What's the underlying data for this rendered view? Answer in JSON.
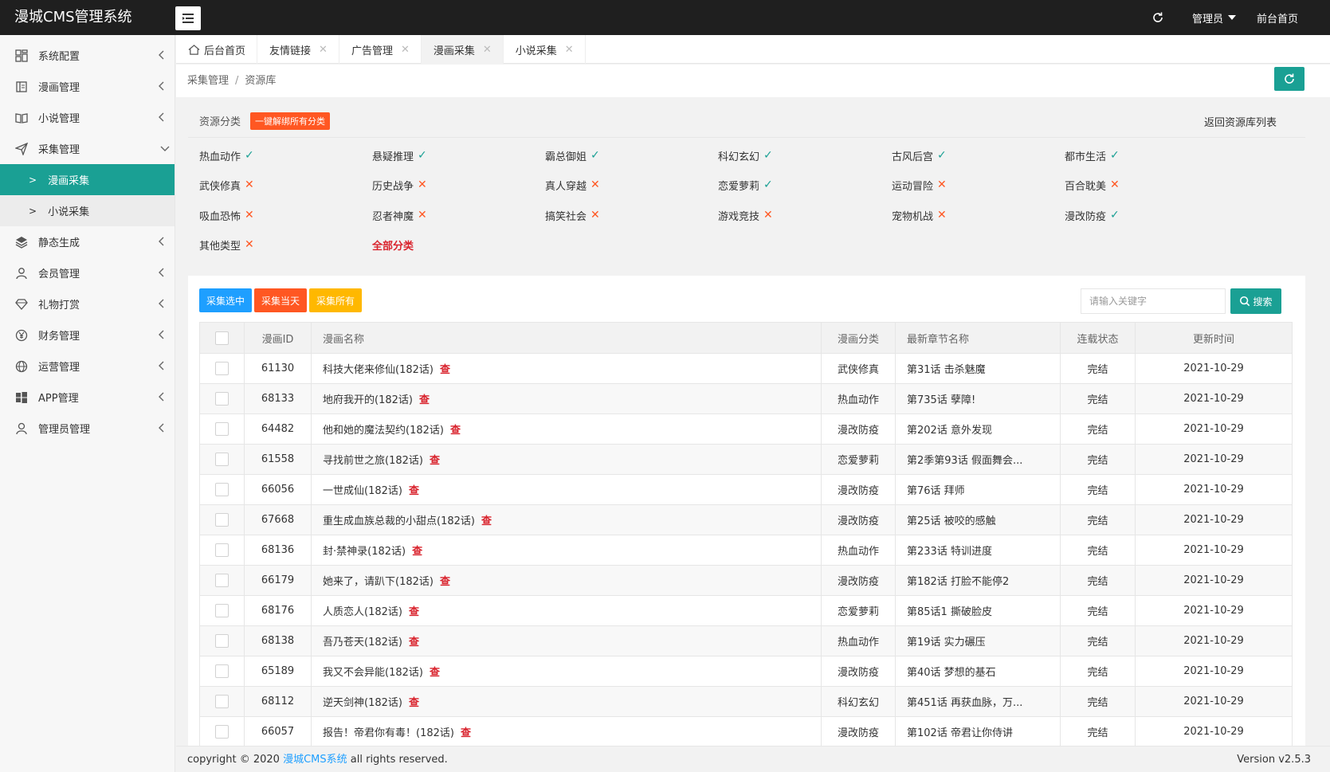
{
  "header": {
    "brand": "漫城CMS管理系统",
    "admin_label": "管理员",
    "front_label": "前台首页"
  },
  "sidebar": {
    "items": [
      {
        "label": "系统配置",
        "icon": "dashboard-icon"
      },
      {
        "label": "漫画管理",
        "icon": "book-icon"
      },
      {
        "label": "小说管理",
        "icon": "open-book-icon"
      },
      {
        "label": "采集管理",
        "icon": "paper-plane-icon",
        "expanded": true
      },
      {
        "label": "静态生成",
        "icon": "layers-icon"
      },
      {
        "label": "会员管理",
        "icon": "users-icon"
      },
      {
        "label": "礼物打赏",
        "icon": "diamond-icon"
      },
      {
        "label": "财务管理",
        "icon": "yen-icon"
      },
      {
        "label": "运营管理",
        "icon": "globe-icon"
      },
      {
        "label": "APP管理",
        "icon": "windows-icon"
      },
      {
        "label": "管理员管理",
        "icon": "user-icon"
      }
    ],
    "sub_items": [
      {
        "label": "漫画采集",
        "active": true
      },
      {
        "label": "小说采集",
        "active": false
      }
    ]
  },
  "tabs": [
    {
      "label": "后台首页",
      "closable": false
    },
    {
      "label": "友情链接",
      "closable": true
    },
    {
      "label": "广告管理",
      "closable": true
    },
    {
      "label": "漫画采集",
      "closable": true,
      "active": true
    },
    {
      "label": "小说采集",
      "closable": true
    }
  ],
  "breadcrumb": [
    "采集管理",
    "资源库"
  ],
  "category_panel": {
    "label": "资源分类",
    "unbind_label": "一键解绑所有分类",
    "back_label": "返回资源库列表",
    "categories": [
      {
        "name": "热血动作",
        "bound": true
      },
      {
        "name": "悬疑推理",
        "bound": true
      },
      {
        "name": "霸总御姐",
        "bound": true
      },
      {
        "name": "科幻玄幻",
        "bound": true
      },
      {
        "name": "古风后宫",
        "bound": true
      },
      {
        "name": "都市生活",
        "bound": true
      },
      {
        "name": "武侠修真",
        "bound": false
      },
      {
        "name": "历史战争",
        "bound": false
      },
      {
        "name": "真人穿越",
        "bound": false
      },
      {
        "name": "恋爱萝莉",
        "bound": true
      },
      {
        "name": "运动冒险",
        "bound": false
      },
      {
        "name": "百合耽美",
        "bound": false
      },
      {
        "name": "吸血恐怖",
        "bound": false
      },
      {
        "name": "忍者神魔",
        "bound": false
      },
      {
        "name": "搞笑社会",
        "bound": false
      },
      {
        "name": "游戏竞技",
        "bound": false
      },
      {
        "name": "宠物机战",
        "bound": false
      },
      {
        "name": "漫改防疫",
        "bound": true
      },
      {
        "name": "其他类型",
        "bound": false
      }
    ],
    "all_label": "全部分类",
    "mark_ok": "✓",
    "mark_no": "✕"
  },
  "toolbar": {
    "collect_selected": "采集选中",
    "collect_today": "采集当天",
    "collect_all": "采集所有",
    "search_placeholder": "请输入关键字",
    "search_label": "搜索"
  },
  "table": {
    "headers": [
      "漫画ID",
      "漫画名称",
      "漫画分类",
      "最新章节名称",
      "连载状态",
      "更新时间"
    ],
    "check_label": "查",
    "rows": [
      {
        "id": "61130",
        "name": "科技大佬来修仙(182话)",
        "category": "武侠修真",
        "chapter": "第31话 击杀魅魔",
        "status": "完结",
        "time": "2021-10-29"
      },
      {
        "id": "68133",
        "name": "地府我开的(182话)",
        "category": "热血动作",
        "chapter": "第735话 孽障!",
        "status": "完结",
        "time": "2021-10-29"
      },
      {
        "id": "64482",
        "name": "他和她的魔法契约(182话)",
        "category": "漫改防疫",
        "chapter": "第202话 意外发现",
        "status": "完结",
        "time": "2021-10-29"
      },
      {
        "id": "61558",
        "name": "寻找前世之旅(182话)",
        "category": "恋爱萝莉",
        "chapter": "第2季第93话 假面舞会...",
        "status": "完结",
        "time": "2021-10-29"
      },
      {
        "id": "66056",
        "name": "一世成仙(182话)",
        "category": "漫改防疫",
        "chapter": "第76话 拜师",
        "status": "完结",
        "time": "2021-10-29"
      },
      {
        "id": "67668",
        "name": "重生成血族总裁的小甜点(182话)",
        "category": "漫改防疫",
        "chapter": "第25话 被咬的感触",
        "status": "完结",
        "time": "2021-10-29"
      },
      {
        "id": "68136",
        "name": "封·禁神录(182话)",
        "category": "热血动作",
        "chapter": "第233话 特训进度",
        "status": "完结",
        "time": "2021-10-29"
      },
      {
        "id": "66179",
        "name": "她来了，请趴下(182话)",
        "category": "漫改防疫",
        "chapter": "第182话 打脸不能停2",
        "status": "完结",
        "time": "2021-10-29"
      },
      {
        "id": "68176",
        "name": "人质恋人(182话)",
        "category": "恋爱萝莉",
        "chapter": "第85话1 撕破脸皮",
        "status": "完结",
        "time": "2021-10-29"
      },
      {
        "id": "68138",
        "name": "吾乃苍天(182话)",
        "category": "热血动作",
        "chapter": "第19话 实力碾压",
        "status": "完结",
        "time": "2021-10-29"
      },
      {
        "id": "65189",
        "name": "我又不会异能(182话)",
        "category": "漫改防疫",
        "chapter": "第40话 梦想的基石",
        "status": "完结",
        "time": "2021-10-29"
      },
      {
        "id": "68112",
        "name": "逆天剑神(182话)",
        "category": "科幻玄幻",
        "chapter": "第451话 再获血脉，万...",
        "status": "完结",
        "time": "2021-10-29"
      },
      {
        "id": "66057",
        "name": "报告！帝君你有毒！(182话)",
        "category": "漫改防疫",
        "chapter": "第102话 帝君让你侍讲",
        "status": "完结",
        "time": "2021-10-29"
      }
    ]
  },
  "footer": {
    "copy_prefix": "copyright © 2020",
    "copy_link": "漫城CMS系统",
    "copy_suffix": "all rights reserved.",
    "version": "Version v2.5.3"
  },
  "colors": {
    "accent": "#1aa094",
    "header_bg": "#1f1f1f",
    "danger": "#ff5722",
    "warning": "#ffb800",
    "info": "#1e9fff"
  }
}
